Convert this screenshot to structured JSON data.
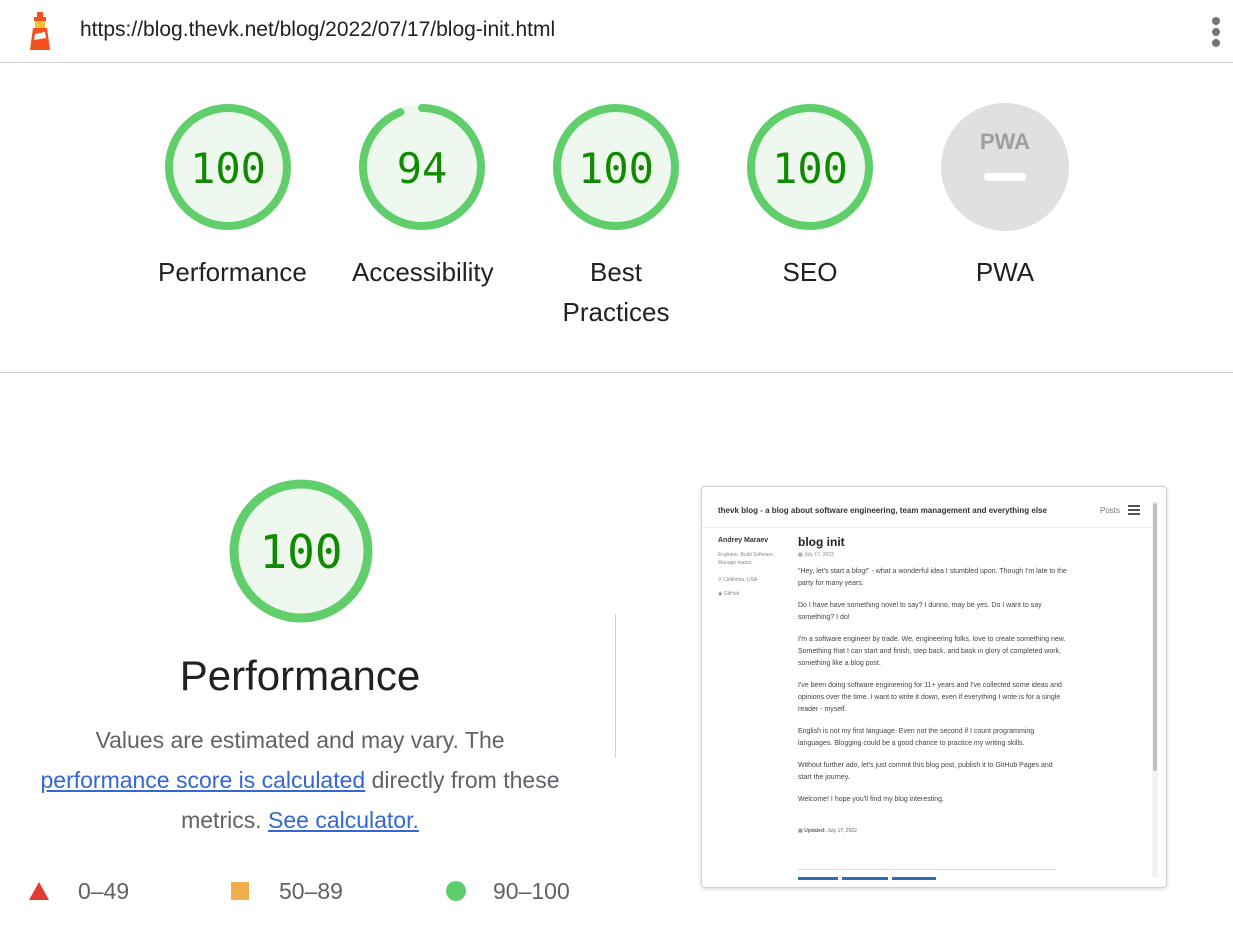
{
  "header": {
    "url": "https://blog.thevk.net/blog/2022/07/17/blog-init.html"
  },
  "categories": [
    {
      "label": "Performance",
      "score": "100",
      "score_value": 100,
      "color": "#0cce6b"
    },
    {
      "label": "Accessibility",
      "score": "94",
      "score_value": 94,
      "color": "#0cce6b"
    },
    {
      "label": "Best Practices",
      "score": "100",
      "score_value": 100,
      "color": "#0cce6b"
    },
    {
      "label": "SEO",
      "score": "100",
      "score_value": 100,
      "color": "#0cce6b"
    },
    {
      "label": "PWA",
      "score": "",
      "score_value": null,
      "badge": "PWA",
      "color": "#e0e0e0"
    }
  ],
  "performance": {
    "score": "100",
    "title": "Performance",
    "desc_part1": "Values are estimated and may vary. The",
    "link1": "performance score is calculated",
    "desc_part2": "directly from these metrics.",
    "link2": "See calculator."
  },
  "legend": [
    {
      "range": "0–49",
      "shape": "triangle",
      "color": "#e53935"
    },
    {
      "range": "50–89",
      "shape": "square",
      "color": "#f0ad4e"
    },
    {
      "range": "90–100",
      "shape": "circle",
      "color": "#5ccf6c"
    }
  ],
  "thumbnail": {
    "site_title": "thevk blog - a blog about software engineering, team management and everything else",
    "nav_posts": "Posts",
    "author": "Andrey Maraev",
    "bio": "Engineer. Build Software. Manage teams.",
    "location": "California, USA",
    "github": "GitHub",
    "post_title": "blog init",
    "post_date": "July 17, 2022",
    "paragraphs": [
      "\"Hey, let's start a blog!\" - what a wonderful idea I stumbled upon. Though I'm late to the party for many years.",
      "Do I have have something novel to say? I dunno, may be yes. Do I want to say something? I do!",
      "I'm a software engineer by trade. We, engineering folks, love to create something new. Something that I can start and finish, step back, and bask in glory of completed work. something like a blog post.",
      "I've been doing software engineering for 11+ years and I've collected some ideas and opinions over the time. I want to write it down, even if everything I write is for a single reader - myself.",
      "English is not my first language. Even not the second if I count programming languages. Blogging could be a good chance to practice my writing skills.",
      "Without further ado, let's just commit this blog post, publish it to GitHub Pages and start the journey.",
      "Welcome! I hope you'll find my blog interesting."
    ],
    "updated_label": "Updated:",
    "updated_date": "July 17, 2022"
  }
}
